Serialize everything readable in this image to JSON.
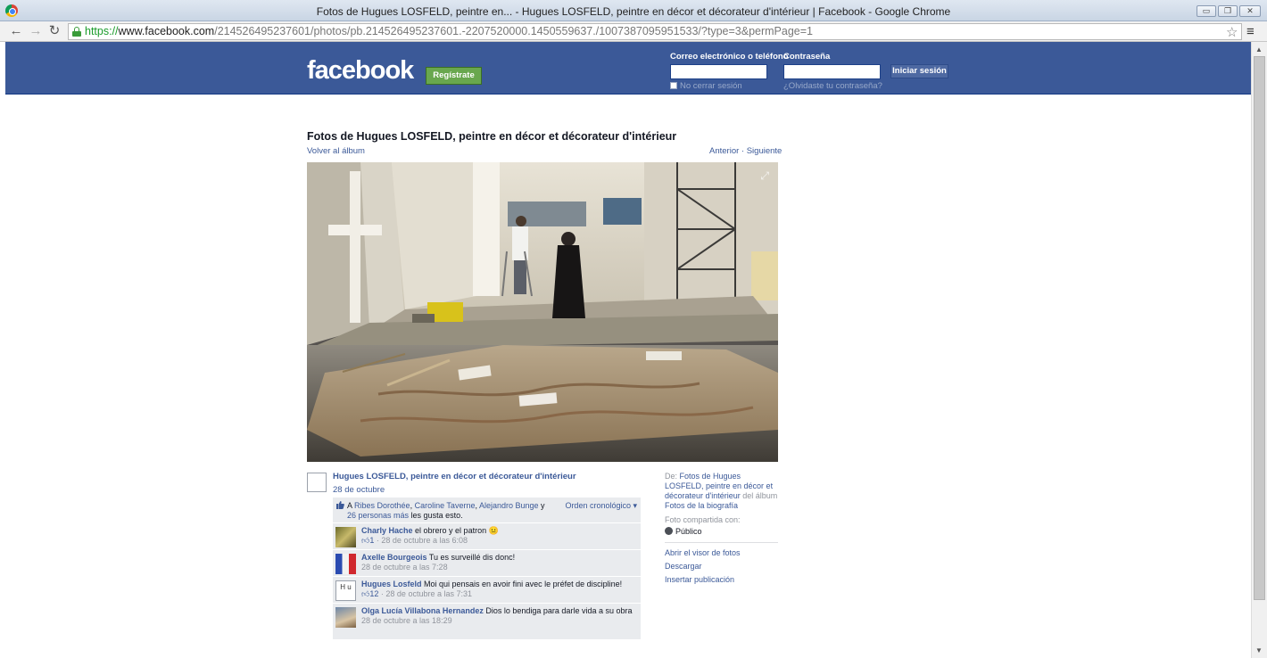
{
  "browser": {
    "window_title": "Fotos de Hugues LOSFELD, peintre en... - Hugues LOSFELD, peintre en décor et décorateur d'intérieur | Facebook - Google Chrome",
    "url_scheme": "https://",
    "url_host": "www.facebook.com",
    "url_path": "/214526495237601/photos/pb.214526495237601.-2207520000.1450559637./1007387095951533/?type=3&permPage=1",
    "back_icon": "←",
    "forward_icon": "→",
    "reload_icon": "↻",
    "star_icon": "☆",
    "menu_icon": "≡"
  },
  "header": {
    "logo": "facebook",
    "register_label": "Regístrate",
    "email_label": "Correo electrónico o teléfono",
    "password_label": "Contraseña",
    "login_label": "Iniciar sesión",
    "keep_label": "No cerrar sesión",
    "forgot_label": "¿Olvidaste tu contraseña?"
  },
  "photo_page": {
    "title": "Fotos de Hugues LOSFELD, peintre en décor et décorateur d'intérieur",
    "back_label": "Volver al álbum",
    "prev_label": "Anterior",
    "separator": " · ",
    "next_label": "Siguiente"
  },
  "post": {
    "owner": "Hugues LOSFELD, peintre en décor et décorateur d'intérieur",
    "date": "28 de octubre",
    "likes_prefix": "A ",
    "liker1": "Ribes Dorothée",
    "sep1": ", ",
    "liker2": "Caroline Taverne",
    "sep2": ", ",
    "liker3": "Alejandro Bunge",
    "likes_mid": " y ",
    "likes_others": "26 personas más",
    "likes_suffix": " les gusta esto.",
    "order_label": "Orden cronológico ▾"
  },
  "comments": [
    {
      "author": "Charly Hache",
      "text": " el obrero y el patron 😐",
      "likes": "1",
      "meta": " · 28 de octubre a las 6:08"
    },
    {
      "author": "Axelle Bourgeois",
      "text": " Tu es surveillé dis donc!",
      "meta": "28 de octubre a las 7:28"
    },
    {
      "author": "Hugues Losfeld",
      "text": " Moi qui pensais en avoir fini avec le préfet de discipline!",
      "likes": "12",
      "meta": " · 28 de octubre a las 7:31",
      "avatar_text": "H u"
    },
    {
      "author": "Olga Lucía Villabona Hernandez",
      "text": " Dios lo bendiga para darle vida a su obra",
      "meta": "28 de octubre a las 18:29"
    }
  ],
  "sidebar": {
    "from_prefix": "De: ",
    "album_link": "Fotos de Hugues LOSFELD, peintre en décor et décorateur d'intérieur",
    "album_mid": " del álbum ",
    "bio_link": "Fotos de la biografía",
    "shared_label": "Foto compartida con:",
    "audience": "Público",
    "open_viewer": "Abrir el visor de fotos",
    "download": "Descargar",
    "embed": "Insertar publicación"
  },
  "colors": {
    "facebook_blue": "#3b5998",
    "register_green": "#69a74e",
    "comments_bg": "#e9ebee"
  }
}
